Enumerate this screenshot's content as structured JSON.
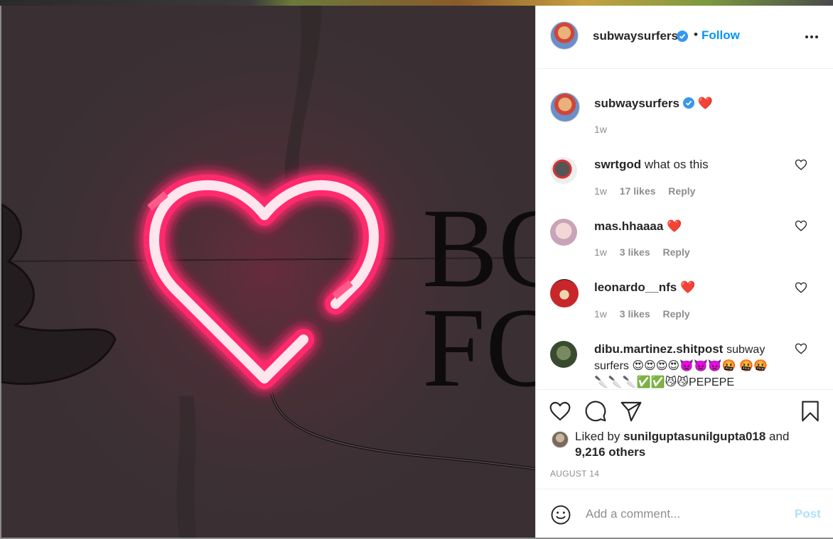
{
  "header": {
    "username": "subwaysurfers",
    "separator": "•",
    "follow_label": "Follow",
    "more_icon": "more-options-icon"
  },
  "caption": {
    "username": "subwaysurfers",
    "text": "❤️",
    "time": "1w"
  },
  "comments": [
    {
      "username": "swrtgod",
      "text": "what os this",
      "time": "1w",
      "likes": "17 likes",
      "reply": "Reply"
    },
    {
      "username": "mas.hhaaaa",
      "text": "❤️",
      "time": "1w",
      "likes": "3 likes",
      "reply": "Reply"
    },
    {
      "username": "leonardo__nfs",
      "text": "❤️",
      "time": "1w",
      "likes": "3 likes",
      "reply": "Reply"
    },
    {
      "username": "dibu.martinez.shitpost",
      "text": "subway surfers 😍😍😍😍👿👿👿🤬 🤬🤬🔪🔪🔪✅✅😼😼PEPEPE"
    }
  ],
  "actions": {
    "like_icon": "heart-icon",
    "comment_icon": "comment-icon",
    "share_icon": "paper-plane-icon",
    "save_icon": "bookmark-icon"
  },
  "likes": {
    "prefix": "Liked by",
    "user": "sunilguptasunilgupta018",
    "middle": "and",
    "others": "9,216 others"
  },
  "date": "AUGUST 14",
  "add_comment": {
    "placeholder": "Add a comment...",
    "post_label": "Post",
    "emoji_icon": "smiley-icon"
  },
  "image": {
    "visible_text_right": "BO FO"
  },
  "colors": {
    "accent": "#0095f6",
    "verified": "#3897f0",
    "heart_red": "#ed4956",
    "neon": "#ff2a6d"
  }
}
